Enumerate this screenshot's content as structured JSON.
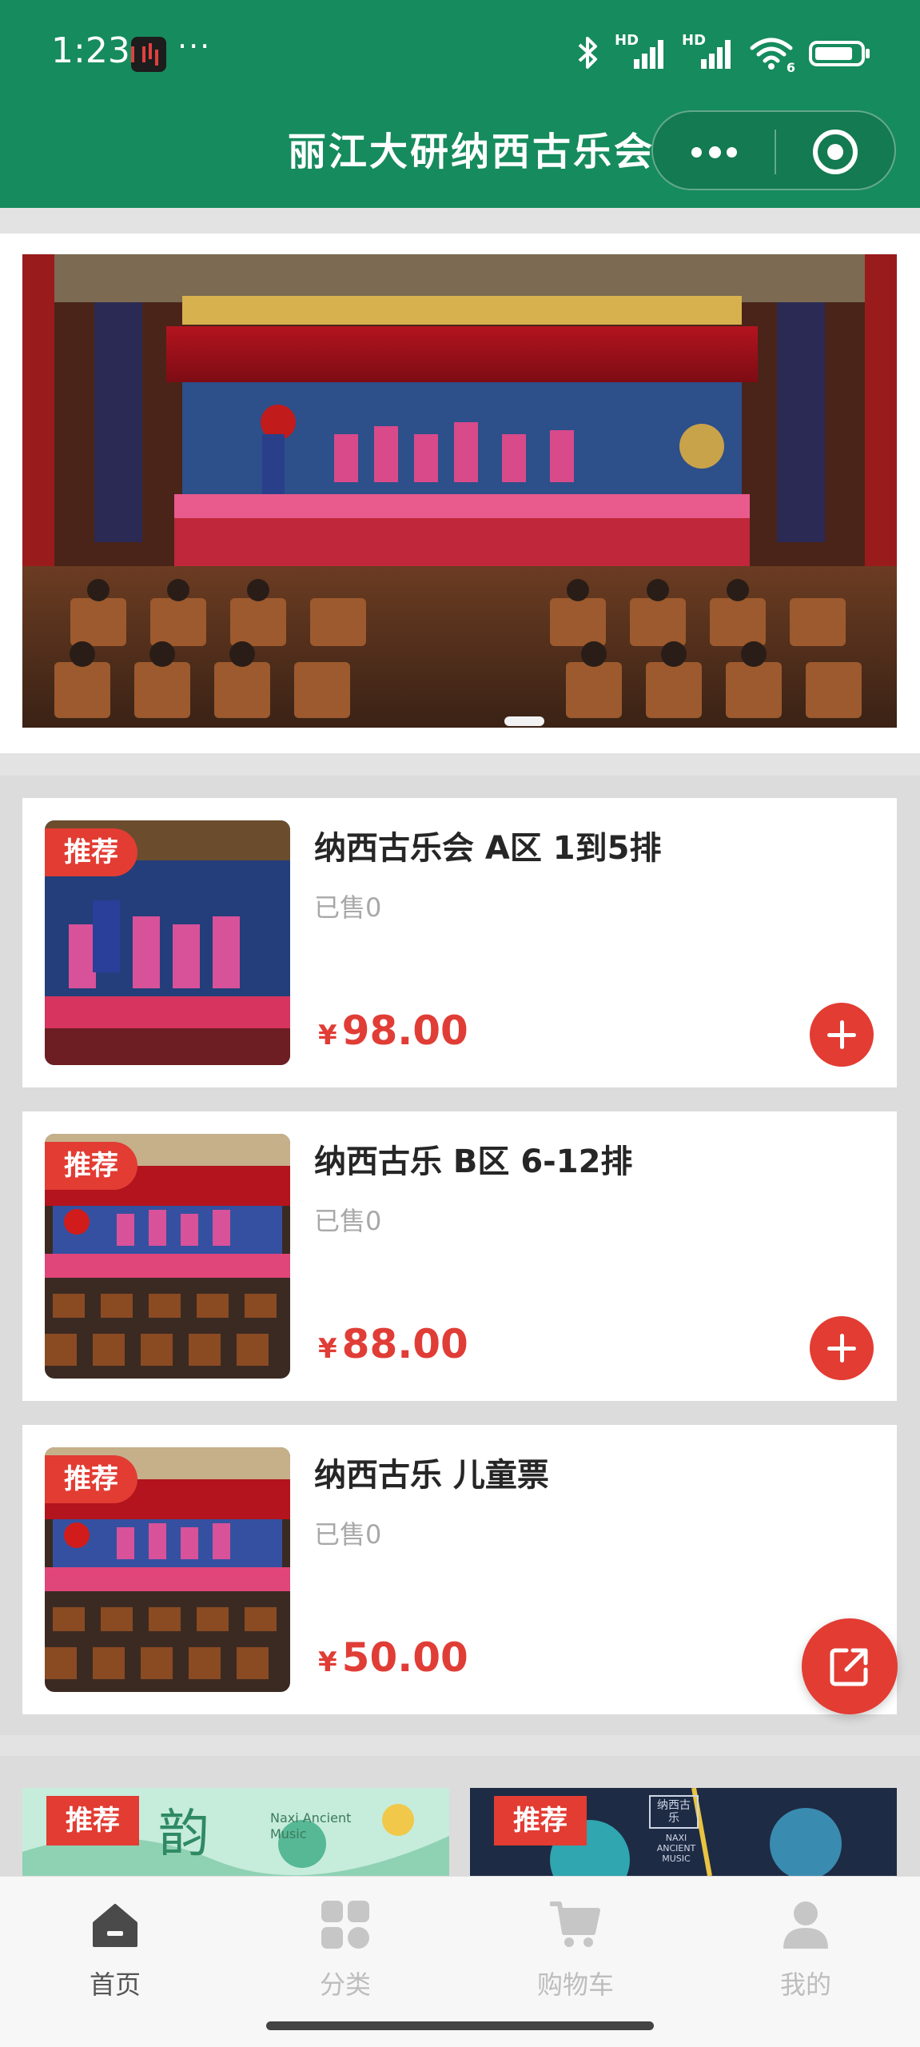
{
  "status_bar": {
    "time": "1:23",
    "dots": "···",
    "signal_labels": [
      "HD",
      "HD"
    ],
    "wifi_label": "6"
  },
  "header": {
    "title": "丽江大研纳西古乐会"
  },
  "banner": {
    "slide_index": 1,
    "slide_count": 1
  },
  "products": [
    {
      "tag": "推荐",
      "title": "纳西古乐会 A区 1到5排",
      "sold": "已售0",
      "currency": "¥",
      "price": "98.00",
      "action": "add"
    },
    {
      "tag": "推荐",
      "title": "纳西古乐 B区 6-12排",
      "sold": "已售0",
      "currency": "¥",
      "price": "88.00",
      "action": "add"
    },
    {
      "tag": "推荐",
      "title": "纳西古乐 儿童票",
      "sold": "已售0",
      "currency": "¥",
      "price": "50.00",
      "action": "share"
    }
  ],
  "recommend": [
    {
      "tag": "推荐",
      "glyph": "韵",
      "caption": "Naxi Ancient Music"
    },
    {
      "tag": "推荐",
      "caption": "NAXI ANCIENT MUSIC",
      "seal": "纳西古乐"
    }
  ],
  "tabs": [
    {
      "label": "首页",
      "icon": "home-icon",
      "active": true
    },
    {
      "label": "分类",
      "icon": "category-icon",
      "active": false
    },
    {
      "label": "购物车",
      "icon": "cart-icon",
      "active": false
    },
    {
      "label": "我的",
      "icon": "user-icon",
      "active": false
    }
  ],
  "colors": {
    "brand_green": "#168b5d",
    "accent_red": "#e23c33",
    "price_red": "#e03d36"
  }
}
